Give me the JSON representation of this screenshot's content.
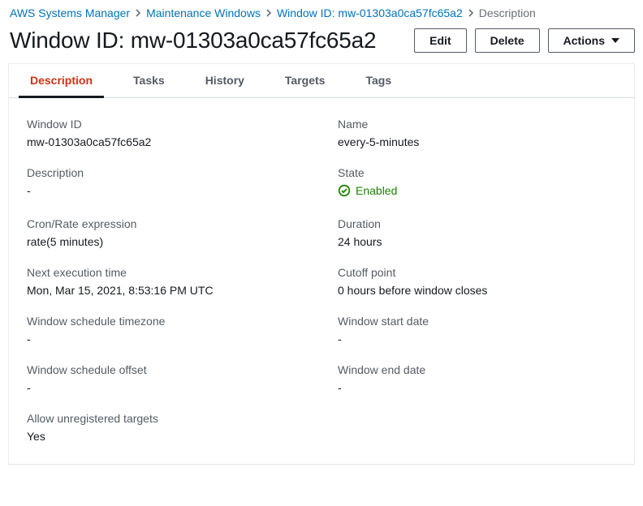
{
  "breadcrumb": {
    "items": [
      {
        "label": "AWS Systems Manager"
      },
      {
        "label": "Maintenance Windows"
      },
      {
        "label": "Window ID: mw-01303a0ca57fc65a2"
      }
    ],
    "current": "Description"
  },
  "header": {
    "title": "Window ID: mw-01303a0ca57fc65a2",
    "edit": "Edit",
    "delete": "Delete",
    "actions": "Actions"
  },
  "tabs": {
    "description": "Description",
    "tasks": "Tasks",
    "history": "History",
    "targets": "Targets",
    "tags": "Tags"
  },
  "fields": {
    "window_id": {
      "label": "Window ID",
      "value": "mw-01303a0ca57fc65a2"
    },
    "name": {
      "label": "Name",
      "value": "every-5-minutes"
    },
    "description": {
      "label": "Description",
      "value": "-"
    },
    "state": {
      "label": "State",
      "value": "Enabled"
    },
    "cron": {
      "label": "Cron/Rate expression",
      "value": "rate(5 minutes)"
    },
    "duration": {
      "label": "Duration",
      "value": "24 hours"
    },
    "next_exec": {
      "label": "Next execution time",
      "value": "Mon, Mar 15, 2021, 8:53:16 PM UTC"
    },
    "cutoff": {
      "label": "Cutoff point",
      "value": "0 hours before window closes"
    },
    "timezone": {
      "label": "Window schedule timezone",
      "value": "-"
    },
    "start_date": {
      "label": "Window start date",
      "value": "-"
    },
    "offset": {
      "label": "Window schedule offset",
      "value": "-"
    },
    "end_date": {
      "label": "Window end date",
      "value": "-"
    },
    "allow_unreg": {
      "label": "Allow unregistered targets",
      "value": "Yes"
    }
  }
}
